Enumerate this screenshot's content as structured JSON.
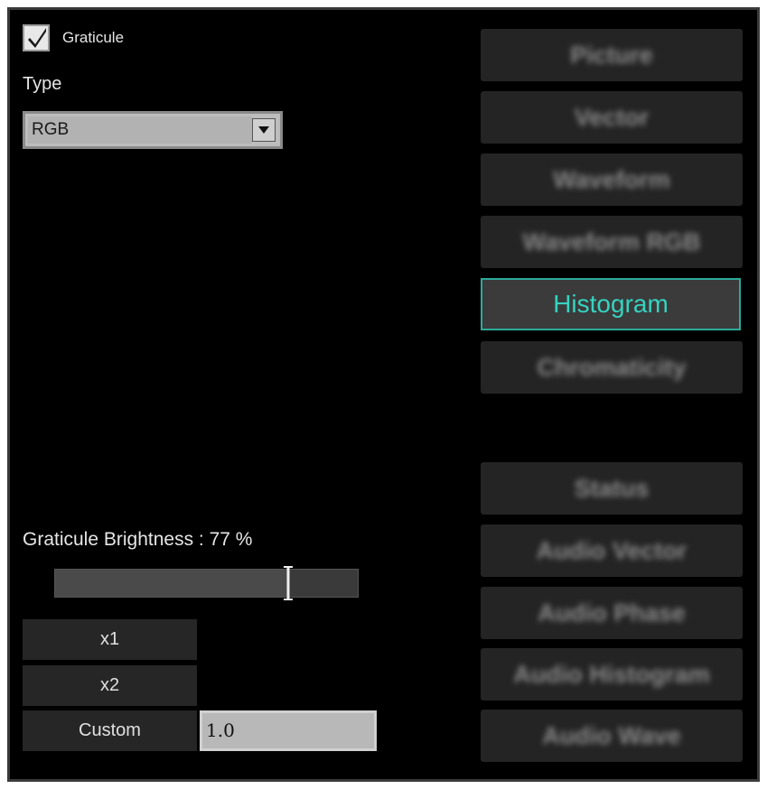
{
  "graticule": {
    "label": "Graticule",
    "checked": true
  },
  "type": {
    "label": "Type",
    "selected": "RGB"
  },
  "views": [
    {
      "label": "Picture",
      "active": false
    },
    {
      "label": "Vector",
      "active": false
    },
    {
      "label": "Waveform",
      "active": false
    },
    {
      "label": "Waveform RGB",
      "active": false
    },
    {
      "label": "Histogram",
      "active": true
    },
    {
      "label": "Chromaticity",
      "active": false
    }
  ],
  "views2": [
    {
      "label": "Status"
    },
    {
      "label": "Audio Vector"
    },
    {
      "label": "Audio Phase"
    },
    {
      "label": "Audio Histogram"
    },
    {
      "label": "Audio Wave"
    }
  ],
  "brightness": {
    "label": "Graticule Brightness : 77 %",
    "value": 0.77
  },
  "zoom": {
    "x1": "x1",
    "x2": "x2",
    "custom": "Custom",
    "custom_value": "1.0"
  },
  "colors": {
    "accent": "#36d3c0",
    "accent_border": "#2ca99a"
  }
}
